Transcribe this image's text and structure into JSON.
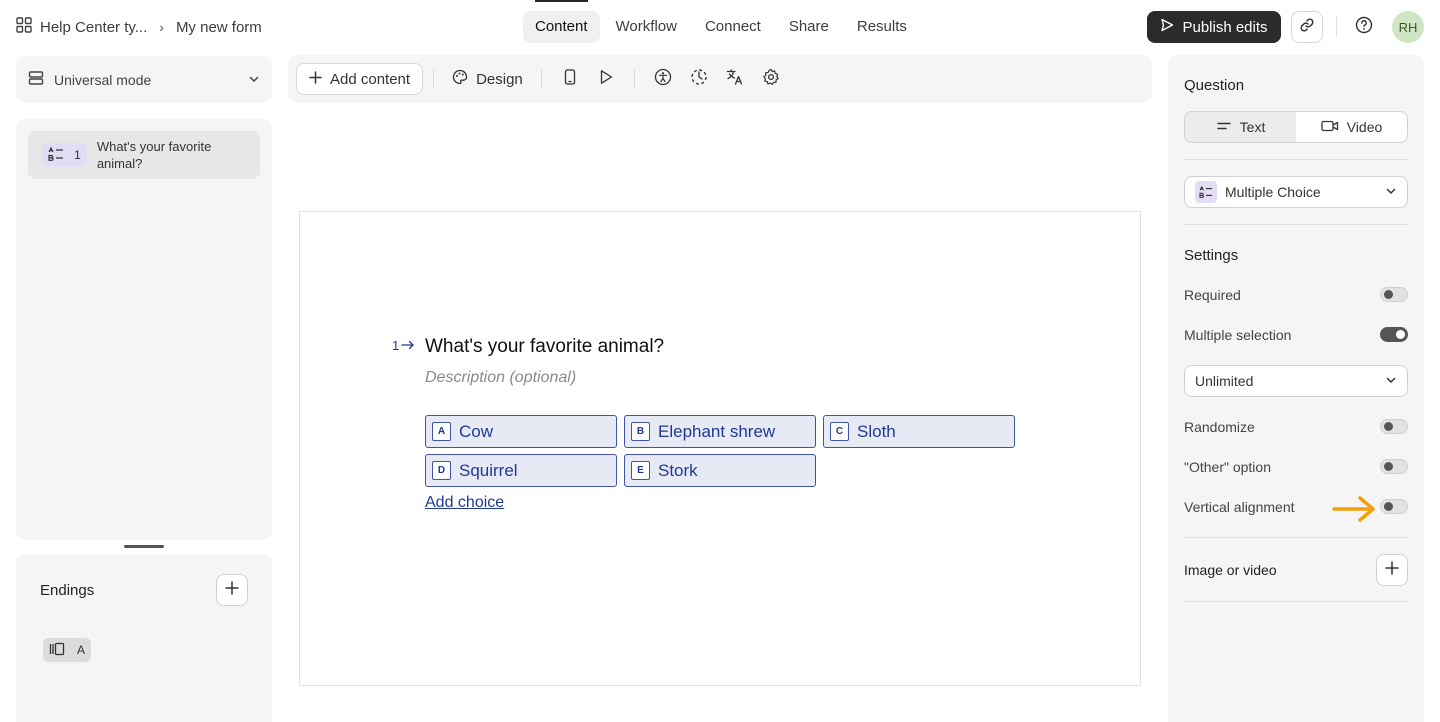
{
  "breadcrumb": {
    "workspace": "Help Center ty...",
    "separator": "›",
    "form_name": "My new form"
  },
  "tabs": [
    "Content",
    "Workflow",
    "Connect",
    "Share",
    "Results"
  ],
  "header": {
    "publish_label": "Publish edits",
    "avatar_initials": "RH"
  },
  "left": {
    "mode_label": "Universal mode",
    "questions": [
      {
        "number": "1",
        "title": "What's your favorite animal?"
      }
    ],
    "endings_title": "Endings",
    "ending_badge": "A"
  },
  "toolbar": {
    "add_content": "Add content",
    "design": "Design"
  },
  "question": {
    "number": "1",
    "title": "What's your favorite animal?",
    "description": "Description (optional)",
    "choices": [
      {
        "key": "A",
        "label": "Cow"
      },
      {
        "key": "B",
        "label": "Elephant shrew"
      },
      {
        "key": "C",
        "label": "Sloth"
      },
      {
        "key": "D",
        "label": "Squirrel"
      },
      {
        "key": "E",
        "label": "Stork"
      }
    ],
    "add_choice": "Add choice"
  },
  "right": {
    "section_question": "Question",
    "seg_text": "Text",
    "seg_video": "Video",
    "type_select": "Multiple Choice",
    "section_settings": "Settings",
    "settings": {
      "required": {
        "label": "Required",
        "on": false
      },
      "multiple_selection": {
        "label": "Multiple selection",
        "on": true
      },
      "limit_select": "Unlimited",
      "randomize": {
        "label": "Randomize",
        "on": false
      },
      "other_option": {
        "label": "\"Other\" option",
        "on": false
      },
      "vertical_alignment": {
        "label": "Vertical alignment",
        "on": false
      }
    },
    "image_or_video": "Image or video"
  },
  "colors": {
    "accent_blue": "#1f3a93",
    "choice_bg": "#e7eaf4",
    "arrow_orange": "#f59e0b",
    "publish_bg": "#2b2b2b"
  }
}
